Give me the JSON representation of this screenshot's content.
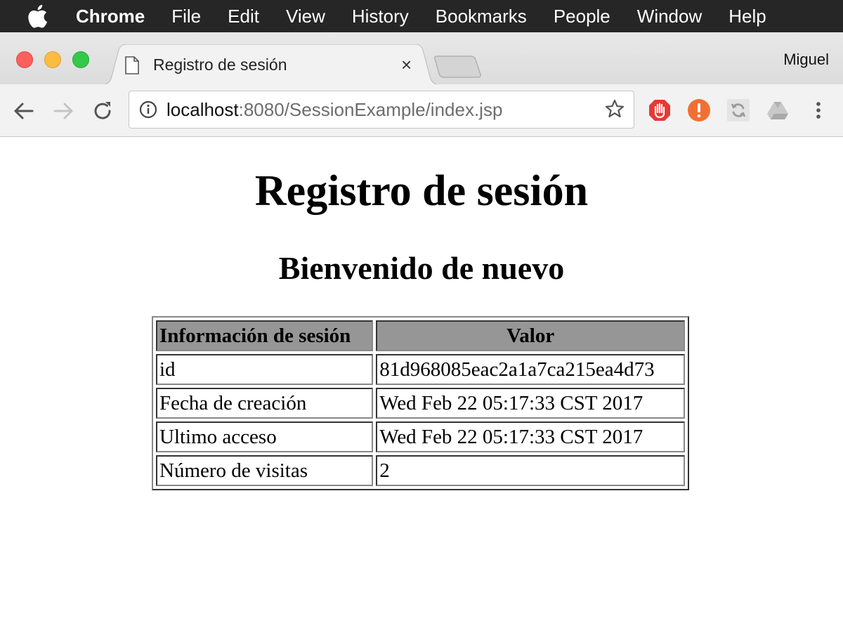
{
  "menubar": {
    "app": "Chrome",
    "items": [
      "File",
      "Edit",
      "View",
      "History",
      "Bookmarks",
      "People",
      "Window",
      "Help"
    ]
  },
  "tab": {
    "title": "Registro de sesión",
    "close": "×"
  },
  "profile": "Miguel",
  "omnibox": {
    "host": "localhost",
    "rest": ":8080/SessionExample/index.jsp"
  },
  "page": {
    "title": "Registro de sesión",
    "subtitle": "Bienvenido de nuevo",
    "table": {
      "headers": [
        "Información de sesión",
        "Valor"
      ],
      "rows": [
        [
          "id",
          "81d968085eac2a1a7ca215ea4d73"
        ],
        [
          "Fecha de creación",
          "Wed Feb 22 05:17:33 CST 2017"
        ],
        [
          "Ultimo acceso",
          "Wed Feb 22 05:17:33 CST 2017"
        ],
        [
          "Número de visitas",
          "2"
        ]
      ]
    }
  },
  "colors": {
    "menubar_bg": "#262626",
    "table_header_bg": "#969696",
    "ext_stop": "#e53935",
    "ext_alert": "#f26f33"
  },
  "icons": [
    "apple-icon",
    "page-icon",
    "close-icon",
    "back-icon",
    "forward-icon",
    "reload-icon",
    "info-icon",
    "star-icon",
    "stop-hand-icon",
    "alert-icon",
    "sync-icon",
    "drive-icon",
    "more-icon"
  ]
}
